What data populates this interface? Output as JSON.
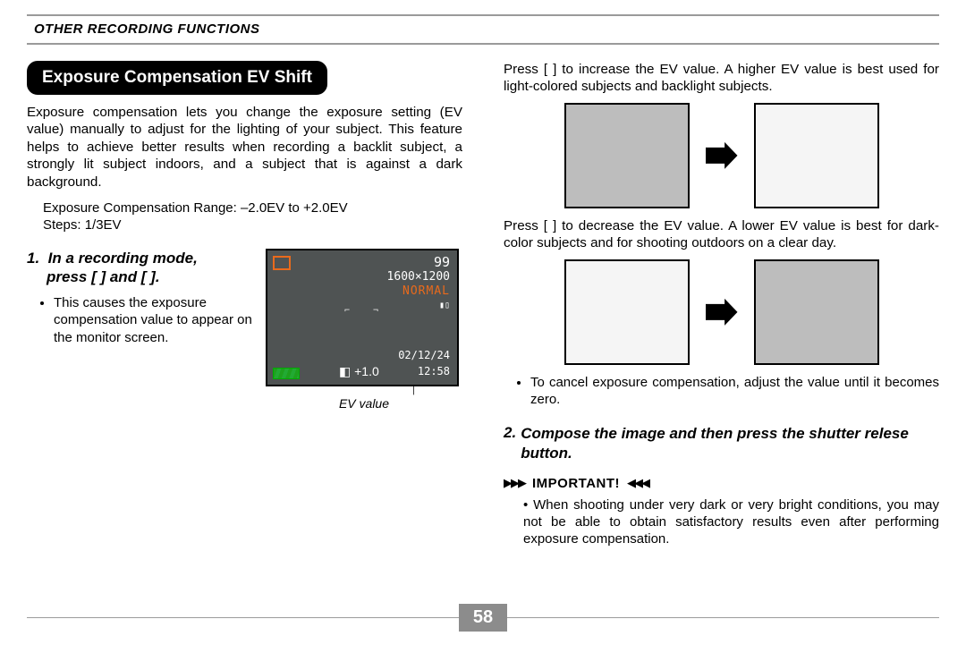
{
  "header": "OTHER RECORDING FUNCTIONS",
  "section_title": "Exposure Compensation EV Shift",
  "intro": "Exposure compensation lets you change the exposure setting (EV value) manually to adjust for the lighting of your subject. This feature helps to achieve better results when recording a backlit subject, a strongly lit subject indoors, and a subject that is against a dark background.",
  "range_line": "Exposure Compensation Range: –2.0EV to +2.0EV",
  "steps_line": "Steps: 1/3EV",
  "step1": {
    "num": "1.",
    "title_a": "In a recording mode,",
    "title_b": "press [ ] and [ ].",
    "bullet": "This causes the exposure compensation value to appear on the monitor screen."
  },
  "lcd": {
    "shots": "99",
    "res": "1600×1200",
    "mode": "NORMAL",
    "date": "02/12/24",
    "time": "12:58",
    "ev": "+1.0"
  },
  "ev_caption": "EV value",
  "increase": "Press [ ] to increase the EV value. A higher EV value is best used for light-colored subjects and backlight subjects.",
  "decrease": "Press [ ] to decrease the EV value. A lower EV value is best for dark-color subjects and for shooting outdoors on a clear day.",
  "cancel_bullet": "To cancel exposure compensation, adjust the value until it becomes zero.",
  "step2": {
    "num": "2.",
    "title": "Compose the image and then press the shutter relese button."
  },
  "important_label": "IMPORTANT!",
  "important_body": "When shooting under very dark or very bright conditions, you may not be able to obtain satisfactory results even after performing exposure compensation.",
  "page_number": "58"
}
